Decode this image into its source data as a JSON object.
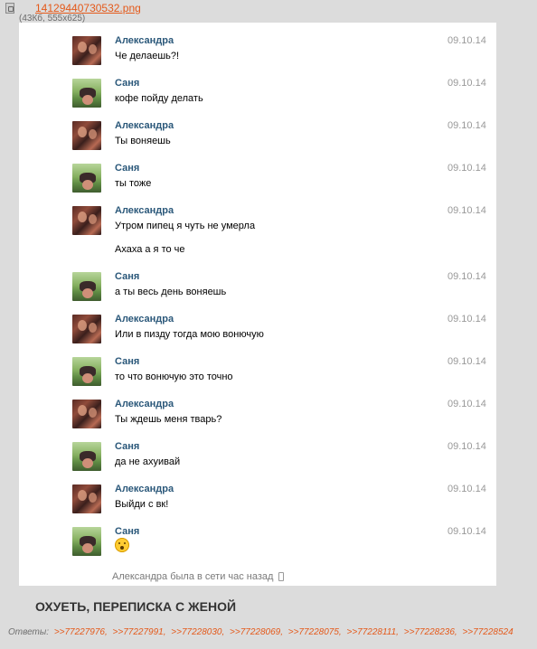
{
  "file": {
    "name": "14129440730532.png",
    "meta": "(43Кб, 555x625)"
  },
  "chat": {
    "messages": [
      {
        "author": "Александра",
        "date": "09.10.14",
        "text": "Че делаешь?!"
      },
      {
        "author": "Саня",
        "date": "09.10.14",
        "text": "кофе пойду делать"
      },
      {
        "author": "Александра",
        "date": "09.10.14",
        "text": "Ты воняешь"
      },
      {
        "author": "Саня",
        "date": "09.10.14",
        "text": "ты тоже"
      },
      {
        "author": "Александра",
        "date": "09.10.14",
        "text": "Утром пипец я чуть не умерла",
        "text2": "Ахаха а я то че"
      },
      {
        "author": "Саня",
        "date": "09.10.14",
        "text": "а ты весь день воняешь"
      },
      {
        "author": "Александра",
        "date": "09.10.14",
        "text": "Или в пизду тогда мою вонючую"
      },
      {
        "author": "Саня",
        "date": "09.10.14",
        "text": "то что вонючую это точно"
      },
      {
        "author": "Александра",
        "date": "09.10.14",
        "text": "Ты ждешь меня тварь?"
      },
      {
        "author": "Саня",
        "date": "09.10.14",
        "text": "да не ахуивай"
      },
      {
        "author": "Александра",
        "date": "09.10.14",
        "text": "Выйди с вк!"
      },
      {
        "author": "Саня",
        "date": "09.10.14",
        "emoji": "shocked-emoji-icon"
      }
    ],
    "status": "Александра была в сети час назад"
  },
  "post": {
    "headline": "ОХУЕТЬ, ПЕРЕПИСКА С ЖЕНОЙ",
    "replies_label": "Ответы:",
    "replies": [
      ">>77227976,",
      ">>77227991,",
      ">>77228030,",
      ">>77228069,",
      ">>77228075,",
      ">>77228111,",
      ">>77228236,",
      ">>77228524"
    ]
  },
  "colors": {
    "page_background": "#dcdcdc",
    "author_name": "#2b587a",
    "link_orange": "#e4591a"
  }
}
